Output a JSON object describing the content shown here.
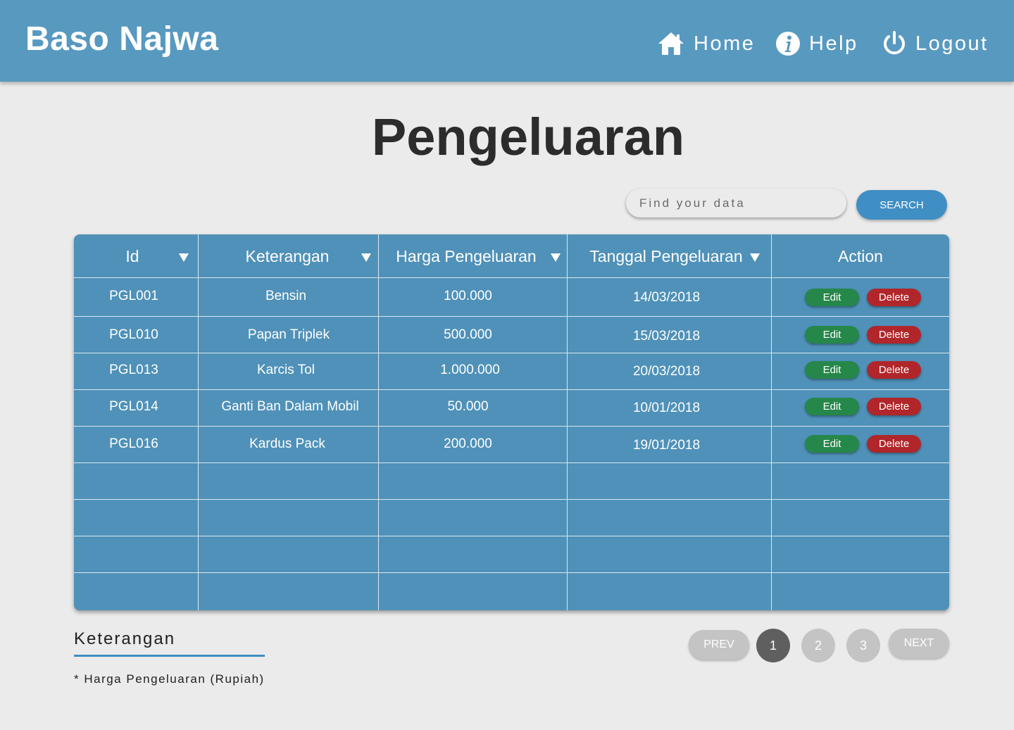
{
  "header": {
    "brand": "Baso Najwa",
    "nav": [
      {
        "label": "Home",
        "icon": "home-icon"
      },
      {
        "label": "Help",
        "icon": "info-icon"
      },
      {
        "label": "Logout",
        "icon": "power-icon"
      }
    ]
  },
  "page_title": "Pengeluaran",
  "search": {
    "placeholder": "Find your data",
    "button_label": "SEARCH"
  },
  "table": {
    "columns": [
      "Id",
      "Keterangan",
      "Harga Pengeluaran",
      "Tanggal Pengeluaran",
      "Action"
    ],
    "rows": [
      {
        "id": "PGL001",
        "keterangan": "Bensin",
        "harga": "100.000",
        "tanggal": "14/03/2018"
      },
      {
        "id": "PGL010",
        "keterangan": "Papan Triplek",
        "harga": "500.000",
        "tanggal": "15/03/2018"
      },
      {
        "id": "PGL013",
        "keterangan": "Karcis Tol",
        "harga": "1.000.000",
        "tanggal": "20/03/2018"
      },
      {
        "id": "PGL014",
        "keterangan": "Ganti Ban Dalam Mobil",
        "harga": "50.000",
        "tanggal": "10/01/2018"
      },
      {
        "id": "PGL016",
        "keterangan": "Kardus Pack",
        "harga": "200.000",
        "tanggal": "19/01/2018"
      }
    ],
    "edit_label": "Edit",
    "delete_label": "Delete"
  },
  "legend": {
    "title": "Keterangan",
    "note": "* Harga Pengeluaran (Rupiah)"
  },
  "pagination": {
    "prev": "PREV",
    "next": "NEXT",
    "pages": [
      "1",
      "2",
      "3"
    ],
    "current": "1"
  },
  "colors": {
    "header": "#5899c0",
    "table": "#4f91b8",
    "accent": "#3f8ec4",
    "edit": "#26874a",
    "delete": "#b0262a"
  }
}
